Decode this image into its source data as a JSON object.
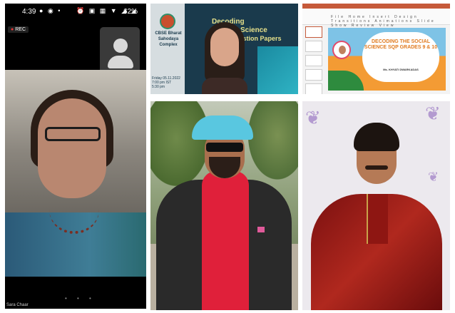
{
  "phone": {
    "status_time": "4:39",
    "battery": "62%",
    "rec_label": "REC",
    "participant_name": "Sara Chaar"
  },
  "session_tile": {
    "org_name": "CBSE Bharat Sahodaya Complex",
    "date_line": "Friday 05.11.2022",
    "time_line_1": "7:00 pm IST",
    "time_line_2": "5:30 pm",
    "title_line_1": "Decoding",
    "title_line_2": "Science",
    "title_line_3": "Question Papers"
  },
  "slide_tile": {
    "slide_title": "DECODING THE SOCIAL SCIENCE SQP GRADES 9 & 10",
    "presenter": "Ms. KHYATI DWARKADAS",
    "ribbon": "File Home Insert Design Transitions Animations Slide Show Review View"
  },
  "colors": {
    "session_bg": "#1a3a4c",
    "slide_orange": "#f39b34",
    "slide_blue": "#7ec3e6",
    "cap": "#59c7e0",
    "sweater": "#e0203a",
    "kurta": "#b0281e"
  }
}
